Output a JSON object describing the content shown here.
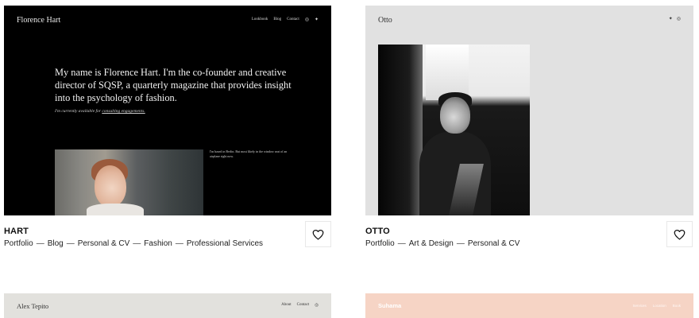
{
  "cards": [
    {
      "title": "HART",
      "tags": [
        "Portfolio",
        "Blog",
        "Personal & CV",
        "Fashion",
        "Professional Services"
      ],
      "separator": "—",
      "preview": {
        "site_name": "Florence Hart",
        "nav": [
          "Lookbook",
          "Blog",
          "Contact"
        ],
        "nav_icons": [
          "instagram-icon",
          "twitter-icon"
        ],
        "intro": "My name is Florence Hart. I'm the co-founder and creative director of SQSP, a quarterly magazine that provides insight into the psychology of fashion.",
        "availability_prefix": "I'm currently available for",
        "availability_link": "consulting engagements.",
        "side_text": "I'm based in Berlin. But most likely in the window seat of an airplane right now."
      },
      "favorite_icon": "heart-icon"
    },
    {
      "title": "OTTO",
      "tags": [
        "Portfolio",
        "Art & Design",
        "Personal & CV"
      ],
      "separator": "—",
      "preview": {
        "site_name": "Otto",
        "nav_icons": [
          "twitter-icon",
          "instagram-icon"
        ]
      },
      "favorite_icon": "heart-icon"
    },
    {
      "preview": {
        "site_name": "Alex Tepito",
        "nav": [
          "About",
          "Contact"
        ],
        "nav_icons": [
          "instagram-icon"
        ]
      }
    },
    {
      "preview": {
        "site_name": "Suhama",
        "nav": [
          "Services",
          "Location",
          "Book"
        ]
      }
    }
  ],
  "colors": {
    "hart_bg": "#000000",
    "otto_bg": "#e1e1e1",
    "alex_bg": "#e2e1dd",
    "suhama_bg": "#f6d4c5"
  }
}
